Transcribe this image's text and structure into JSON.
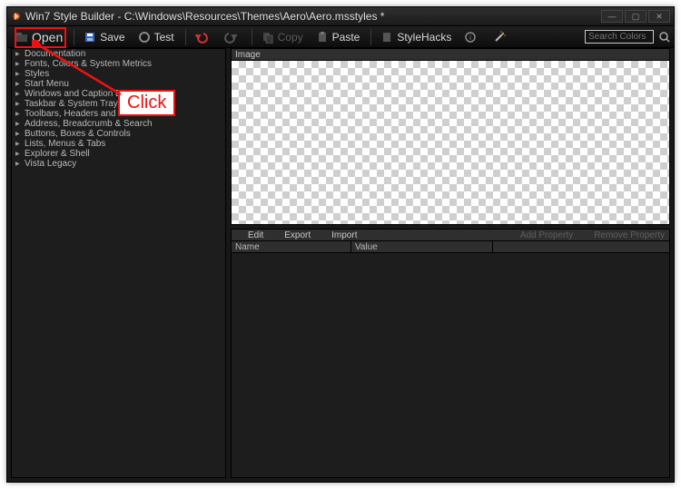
{
  "window": {
    "title": "Win7 Style Builder - C:\\Windows\\Resources\\Themes\\Aero\\Aero.msstyles *"
  },
  "toolbar": {
    "open": "Open",
    "save": "Save",
    "test": "Test",
    "copy": "Copy",
    "paste": "Paste",
    "stylehacks": "StyleHacks"
  },
  "search": {
    "placeholder": "Search Colors"
  },
  "tree": {
    "items": [
      "Documentation",
      "Fonts, Colors & System Metrics",
      "Styles",
      "Start Menu",
      "Windows and Caption Buttons",
      "Taskbar & System Tray",
      "Toolbars, Headers and Rebar",
      "Address, Breadcrumb & Search",
      "Buttons, Boxes & Controls",
      "Lists, Menus & Tabs",
      "Explorer & Shell",
      "Vista Legacy"
    ]
  },
  "image_panel": {
    "title": "Image"
  },
  "prop_toolbar": {
    "edit": "Edit",
    "export": "Export",
    "import": "Import",
    "add": "Add Property",
    "remove": "Remove Property"
  },
  "prop_table": {
    "col_name": "Name",
    "col_value": "Value"
  },
  "annotation": {
    "label": "Click"
  }
}
